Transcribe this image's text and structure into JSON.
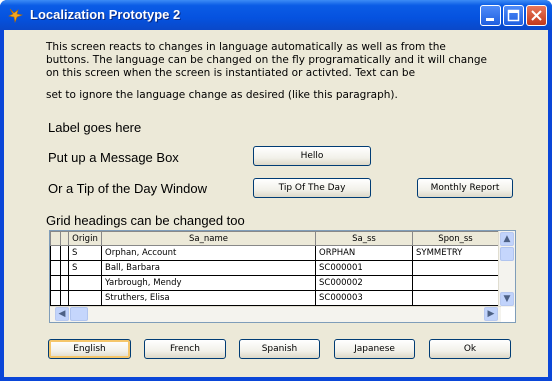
{
  "window": {
    "title": "Localization Prototype 2",
    "colors": {
      "titlebar": "#0552df",
      "client": "#ece9d8",
      "close_button": "#c2391b"
    }
  },
  "intro": {
    "paragraph": "This screen reacts to changes in language automatically as well as from the\nbuttons.  The language can be changed on the fly programatically and it will change\non this screen when the screen is instantiated or activted.  Text can be",
    "paragraph_2": "set to ignore the language change as desired (like this paragraph)."
  },
  "labels": {
    "label_goes_here": "Label goes here",
    "message_box": "Put up a Message Box",
    "tip_window": "Or a Tip of the Day Window",
    "grid_headings": "Grid headings can be changed too"
  },
  "buttons": {
    "hello": "Hello",
    "tip_of_the_day": "Tip Of The Day",
    "monthly_report": "Monthly Report"
  },
  "grid": {
    "columns": [
      "Origin",
      "Sa_name",
      "Sa_ss",
      "Spon_ss"
    ],
    "rows": [
      {
        "origin": "S",
        "sa_name": "Orphan, Account",
        "sa_ss": "ORPHAN",
        "spon_ss": "SYMMETRY"
      },
      {
        "origin": "S",
        "sa_name": "Ball, Barbara",
        "sa_ss": "SC000001",
        "spon_ss": ""
      },
      {
        "origin": "",
        "sa_name": "Yarbrough, Mendy",
        "sa_ss": "SC000002",
        "spon_ss": ""
      },
      {
        "origin": "",
        "sa_name": "Struthers, Elisa",
        "sa_ss": "SC000003",
        "spon_ss": ""
      }
    ]
  },
  "footer": {
    "english": "English",
    "french": "French",
    "spanish": "Spanish",
    "japanese": "Japanese",
    "ok": "Ok"
  }
}
